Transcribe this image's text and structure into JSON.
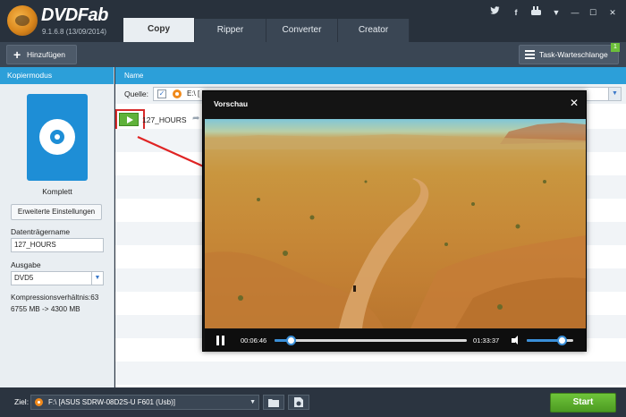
{
  "app": {
    "name": "DVDFab",
    "version": "9.1.6.8 (13/09/2014)"
  },
  "tabs": [
    {
      "label": "Copy",
      "active": true
    },
    {
      "label": "Ripper",
      "active": false
    },
    {
      "label": "Converter",
      "active": false
    },
    {
      "label": "Creator",
      "active": false
    }
  ],
  "window_controls": {
    "twitter": "twitter-icon",
    "facebook": "facebook-icon",
    "youtube": "youtube-icon",
    "menu": "▼",
    "minimize": "—",
    "maximize": "☐",
    "close": "✕"
  },
  "toolbar": {
    "add_label": "Hinzufügen",
    "queue_label": "Task-Warteschlange",
    "queue_count": "1"
  },
  "left": {
    "header": "Kopiermodus",
    "mode_name": "Komplett",
    "advanced_button": "Erweiterte Einstellungen",
    "volume_label": "Datenträgername",
    "volume_value": "127_HOURS",
    "output_label": "Ausgabe",
    "output_value": "DVD5",
    "compression_line1": "Kompressionsverhältnis:63",
    "compression_line2": "6755 MB -> 4300 MB"
  },
  "right": {
    "column_header": "Name",
    "source_label": "Quelle:",
    "source_value": "E:\\ [",
    "title_name": "127_HOURS"
  },
  "preview": {
    "title": "Vorschau",
    "close": "✕",
    "time_current": "00:06:46",
    "time_total": "01:33:37",
    "seek_progress": 0.085,
    "volume_level": 0.75
  },
  "bottom": {
    "target_label": "Ziel:",
    "target_value": "F:\\ [ASUS SDRW-08D2S-U F601 (Usb)]",
    "start_label": "Start"
  },
  "colors": {
    "accent_blue": "#2c9fd9",
    "start_green": "#5fb23a",
    "highlight_red": "#d62b2b"
  }
}
